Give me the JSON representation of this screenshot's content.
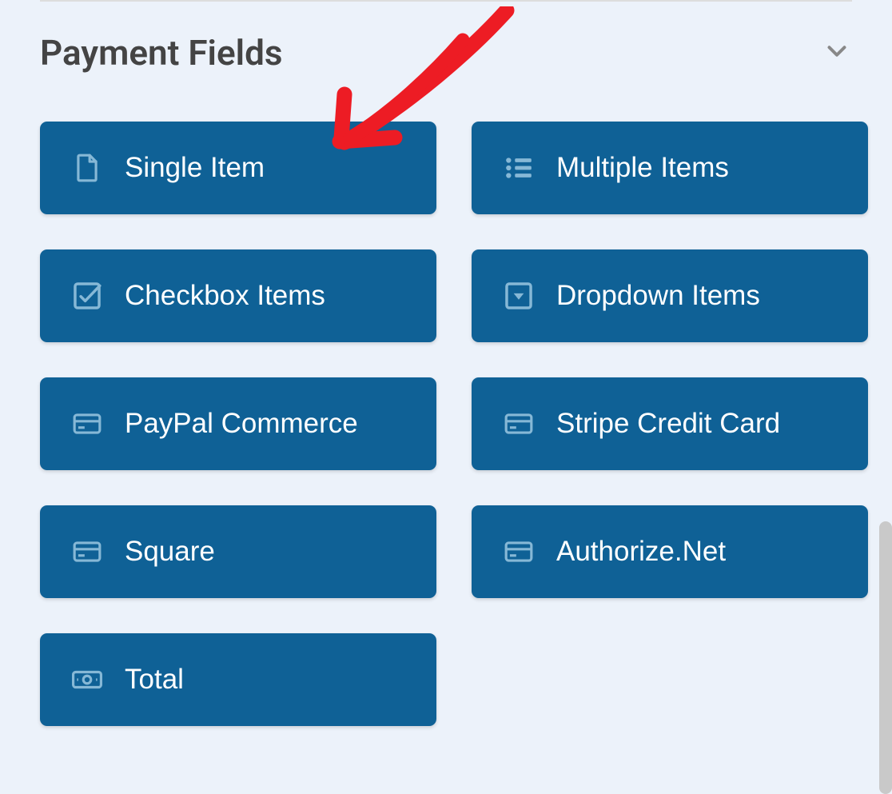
{
  "section": {
    "title": "Payment Fields"
  },
  "fields": [
    {
      "label": "Single Item",
      "icon": "file-icon"
    },
    {
      "label": "Multiple Items",
      "icon": "list-icon"
    },
    {
      "label": "Checkbox Items",
      "icon": "checkbox-icon"
    },
    {
      "label": "Dropdown Items",
      "icon": "dropdown-icon"
    },
    {
      "label": "PayPal Commerce",
      "icon": "card-icon"
    },
    {
      "label": "Stripe Credit Card",
      "icon": "card-icon"
    },
    {
      "label": "Square",
      "icon": "card-icon"
    },
    {
      "label": "Authorize.Net",
      "icon": "card-icon"
    },
    {
      "label": "Total",
      "icon": "money-icon"
    }
  ],
  "annotation": {
    "color": "#ed1c24"
  }
}
